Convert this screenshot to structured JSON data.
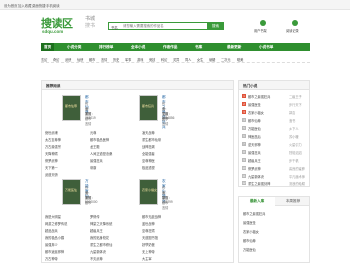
{
  "topbar": {
    "links": [
      "设为首页",
      "加入收藏",
      "桌面快捷",
      "手机阅读"
    ]
  },
  "logo": {
    "main": "搜读区",
    "sub1": "书城",
    "sub2": "搜书",
    "domain": "sdqu.com"
  },
  "search": {
    "select": "书名",
    "placeholder": "请您输入需要搜索的作品名",
    "button": "搜索"
  },
  "header_icons": [
    "用户书架",
    "阅读记录"
  ],
  "nav": [
    "首页",
    "小说分类",
    "排行榜单",
    "全本小说",
    "作者作品",
    "书库",
    "最新更新",
    "小说书单"
  ],
  "subnav": [
    "玄幻",
    "奇幻",
    "武侠",
    "仙侠",
    "都市",
    "言情",
    "历史",
    "军事",
    "游戏",
    "竞技",
    "科幻",
    "灵异",
    "同人",
    "女生",
    "悬疑",
    "二次元",
    "耽美"
  ],
  "featured": {
    "title": "推荐阅读",
    "books": [
      {
        "title": "都市仙尊",
        "author": "作者：未知",
        "category": "分类：都市言情",
        "count": "字数：763019",
        "cover": "都市仙尊"
      },
      {
        "title": "都市之最强狂兵",
        "author": "作者：二级王子",
        "category": "分类：都市言情",
        "count": "字数：2034856",
        "cover": "都市狂兵"
      },
      {
        "title": "万能医仙",
        "author": "作者：未知",
        "category": "分类：都市",
        "count": "字数：5000000",
        "cover": "万能医仙"
      },
      {
        "title": "农家小福女",
        "author": "作者：郭嘉",
        "category": "分类：都市言情",
        "count": "字数：102299",
        "cover": "农家小福女"
      }
    ],
    "list_left": [
      "绝世武魂",
      "太古至尊神",
      "万古最强宗",
      "天降神婿",
      "修罗武神",
      "天下第一",
      "武道天骄"
    ],
    "list_mid": [
      "元尊",
      "都市极品医神",
      "龙王殿",
      "人间正道是沧桑",
      "最强狂兵",
      "帝霸"
    ],
    "list_right": [
      "凌天战尊",
      "重生都市仙帝",
      "战神狂飙",
      "全能强者",
      "至尊神医",
      "极品透视"
    ],
    "list_bottom_left": [
      "我是大明星",
      "网游之修罗传说",
      "超品战兵",
      "我的极品小姨",
      "最强弃少",
      "都市逍遥邪神",
      "万古神帝"
    ],
    "list_bottom_mid": [
      "罗修传",
      "神豪之天降系统",
      "超级兵王",
      "我的贴身校花",
      "重生之都市修仙",
      "九星霸体诀",
      "不灭武尊"
    ],
    "list_bottom_right": [
      "都市无敌战神",
      "盖世战神",
      "至尊狂婿",
      "天道图书馆",
      "妖孽奶爸",
      "无上神帝",
      "大主宰"
    ]
  },
  "hot": {
    "title": "热门小说",
    "items": [
      {
        "name": "都市之最强狂兵",
        "author": "二级王子"
      },
      {
        "name": "最强医圣",
        "author": "步行天下"
      },
      {
        "name": "农家小福女",
        "author": "郭嘉"
      },
      {
        "name": "都市仙尊",
        "author": "洛书"
      },
      {
        "name": "万能医仙",
        "author": "乡下人"
      },
      {
        "name": "神医凰后",
        "author": "苏小暖"
      },
      {
        "name": "逆天邪神",
        "author": "火星引力"
      },
      {
        "name": "最强狂兵",
        "author": "烈焰滔滔"
      },
      {
        "name": "超级兵王",
        "author": "步千帆"
      },
      {
        "name": "修罗武神",
        "author": "善良的蜜蜂"
      },
      {
        "name": "九星霸体诀",
        "author": "平凡魔术师"
      },
      {
        "name": "重生之最强剑神",
        "author": "流浪的蛤蟆"
      }
    ]
  },
  "bottom_tabs": [
    "最新入库",
    "本周推荐"
  ],
  "bottom_list": [
    "都市之最强狂兵",
    "最强医圣",
    "农家小福女",
    "都市仙尊",
    "万能医仙"
  ]
}
